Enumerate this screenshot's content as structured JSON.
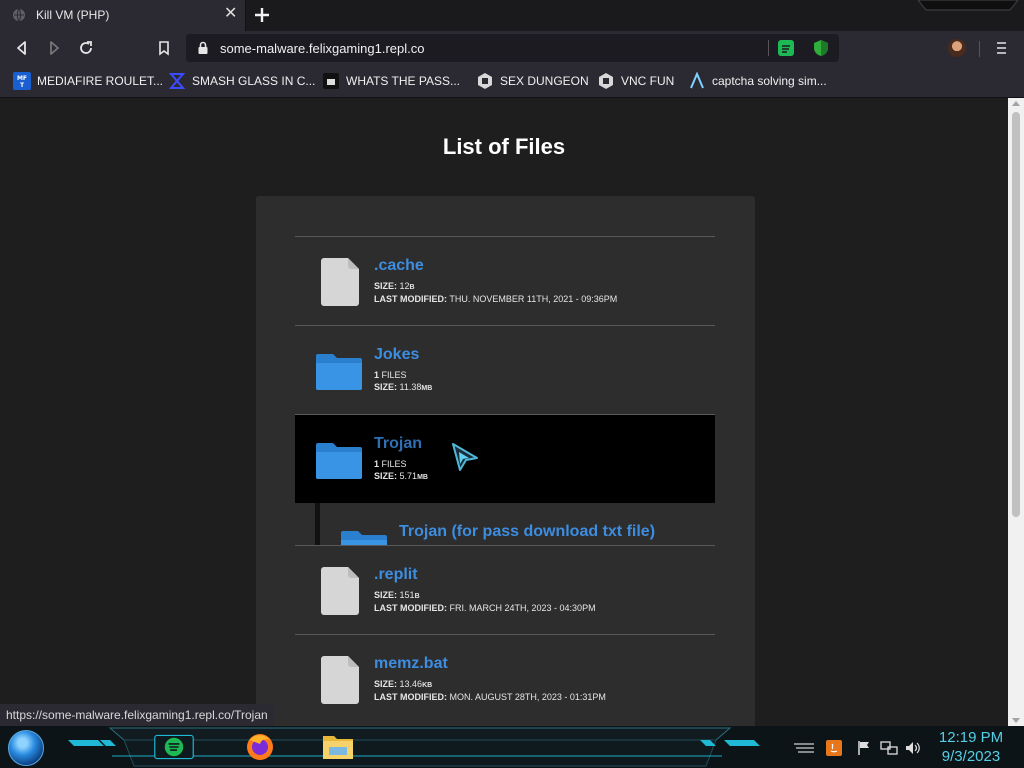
{
  "browser": {
    "tab_title": "Kill VM (PHP)",
    "url": "some-malware.felixgaming1.repl.co",
    "bookmarks": [
      {
        "label": "MEDIAFIRE ROULET...",
        "icon": "mediafire-icon"
      },
      {
        "label": "SMASH GLASS IN C...",
        "icon": "smash-glass-icon"
      },
      {
        "label": "WHATS THE PASS...",
        "icon": "terminal-icon"
      },
      {
        "label": "SEX DUNGEON",
        "icon": "replit-icon"
      },
      {
        "label": "VNC FUN",
        "icon": "replit-icon"
      },
      {
        "label": "captcha solving sim...",
        "icon": "arrow-logo-icon"
      }
    ],
    "status_url": "https://some-malware.felixgaming1.repl.co/Trojan"
  },
  "page": {
    "title": "List of Files",
    "size_label": "SIZE:",
    "modified_label": "LAST MODIFIED:",
    "files_label": "FILES",
    "items": [
      {
        "type": "file",
        "name": ".cache",
        "size": "12",
        "unit": "B",
        "modified": "THU. NOVEMBER 11TH, 2021 - 09:36PM"
      },
      {
        "type": "folder",
        "name": "Jokes",
        "count": "1",
        "size": "11.38",
        "unit": "MB"
      },
      {
        "type": "folder",
        "name": "Trojan",
        "count": "1",
        "size": "5.71",
        "unit": "MB",
        "selected": true
      },
      {
        "type": "subfolder",
        "name": "Trojan (for pass download txt file)"
      },
      {
        "type": "file",
        "name": ".replit",
        "size": "151",
        "unit": "B",
        "modified": "FRI. MARCH 24TH, 2023 - 04:30PM"
      },
      {
        "type": "file",
        "name": "memz.bat",
        "size": "13.46",
        "unit": "KB",
        "modified": "MON. AUGUST 28TH, 2023 - 01:31PM"
      }
    ]
  },
  "taskbar": {
    "time": "12:19 PM",
    "date": "9/3/2023",
    "apps": [
      "spotify-icon",
      "firefox-icon",
      "file-explorer-icon"
    ]
  },
  "colors": {
    "accent": "#3d8de0",
    "page_bg": "#1e1e1e",
    "panel_bg": "#2d2d2d",
    "selected_row": "#000000",
    "clock": "#55cfe6"
  }
}
